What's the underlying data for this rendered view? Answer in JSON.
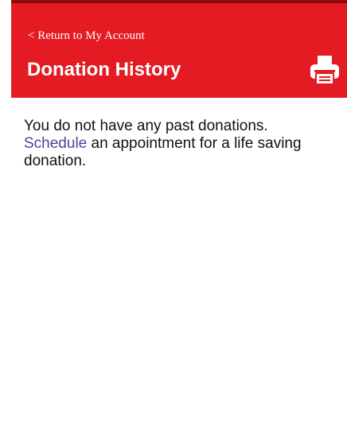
{
  "header": {
    "back_link": "< Return to My Account",
    "title": "Donation History",
    "print_icon": "printer-icon"
  },
  "main": {
    "message_line": "You do not have any past donations.",
    "schedule_link": "Schedule",
    "message_rest": " an appointment for a life saving donation."
  },
  "colors": {
    "header_red": "#e41b23",
    "header_strip": "#8f0a10",
    "link_purple": "#5b3d96",
    "text": "#111111"
  }
}
